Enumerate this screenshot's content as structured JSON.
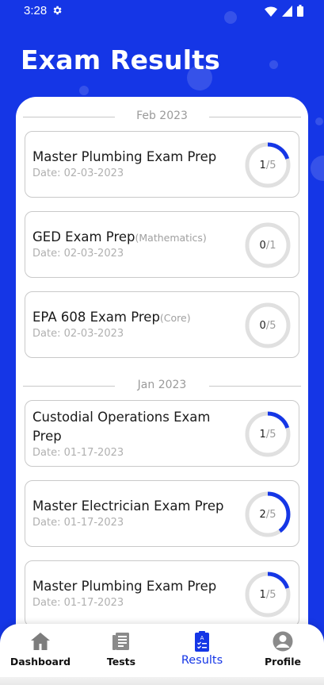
{
  "status_bar": {
    "time": "3:28"
  },
  "page_title": "Exam Results",
  "accent_color": "#1536e6",
  "groups": [
    {
      "month": "Feb 2023",
      "exams": [
        {
          "title": "Master Plumbing Exam Prep",
          "subtitle": "",
          "date": "Date: 02-03-2023",
          "score": "1",
          "total": "/5",
          "fraction": 0.2
        },
        {
          "title": "GED Exam Prep",
          "subtitle": "(Mathematics)",
          "date": "Date: 02-03-2023",
          "score": "0",
          "total": "/1",
          "fraction": 0
        },
        {
          "title": "EPA 608 Exam Prep",
          "subtitle": "(Core)",
          "date": "Date: 02-03-2023",
          "score": "0",
          "total": "/5",
          "fraction": 0
        }
      ]
    },
    {
      "month": "Jan 2023",
      "exams": [
        {
          "title": "Custodial Operations Exam",
          "title_line2": "Prep",
          "subtitle": "",
          "date": "Date: 01-17-2023",
          "score": "1",
          "total": "/5",
          "fraction": 0.2
        },
        {
          "title": "Master Electrician Exam Prep",
          "subtitle": "",
          "date": "Date: 01-17-2023",
          "score": "2",
          "total": "/5",
          "fraction": 0.4
        },
        {
          "title": "Master Plumbing Exam Prep",
          "subtitle": "",
          "date": "Date: 01-17-2023",
          "score": "1",
          "total": "/5",
          "fraction": 0.2
        }
      ]
    }
  ],
  "nav": {
    "dashboard": {
      "label": "Dashboard",
      "icon": "home-icon"
    },
    "tests": {
      "label": "Tests",
      "icon": "document-icon"
    },
    "results": {
      "label": "Results",
      "icon": "clipboard-icon"
    },
    "profile": {
      "label": "Profile",
      "icon": "person-icon"
    }
  }
}
